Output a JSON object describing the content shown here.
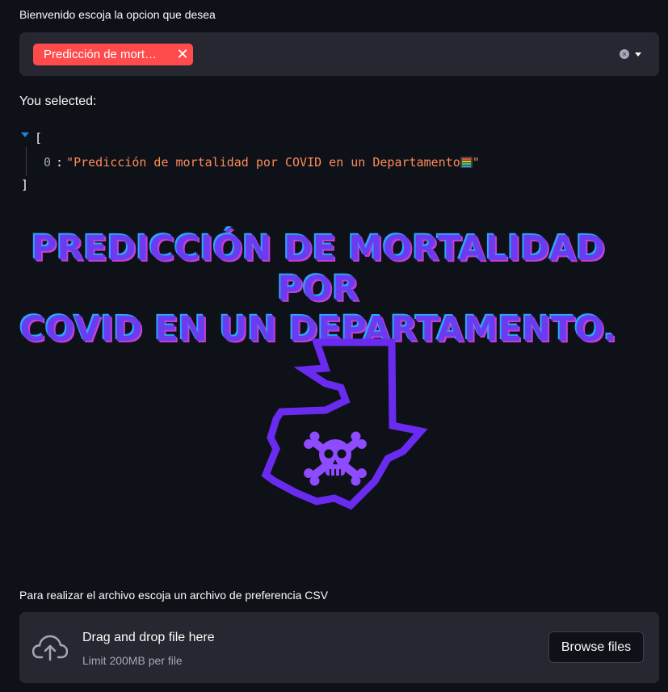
{
  "select": {
    "label": "Bienvenido escoja la opcion que desea",
    "chip_text": "Predicción de mort…",
    "chip_remove": "✕",
    "clear_icon": "×",
    "arrow_icon": "chevron-down-icon"
  },
  "selection": {
    "label": "You selected:",
    "open_bracket": "[",
    "close_bracket": "]",
    "items": [
      {
        "index": "0",
        "value": "\"Predicción de mortalidad por COVID en un Departamento",
        "emoji": "abacus-icon",
        "quote_end": "\""
      }
    ]
  },
  "hero": {
    "title_line1": "PREDICCIÓN DE MORTALIDAD POR",
    "title_line2": "COVID EN UN DEPARTAMENTO.",
    "image": "guatemala-map-skull-icon"
  },
  "upload": {
    "label": "Para realizar el archivo escoja un archivo de preferencia CSV",
    "dropzone_title": "Drag and drop file here",
    "dropzone_limit": "Limit 200MB per file",
    "browse_label": "Browse files",
    "icon": "cloud-upload-icon"
  },
  "colors": {
    "background": "#0e1117",
    "panel": "#262730",
    "chip": "#ff4b4b",
    "accent_purple": "#6b3bf0",
    "json_string": "#fe8b5a"
  }
}
